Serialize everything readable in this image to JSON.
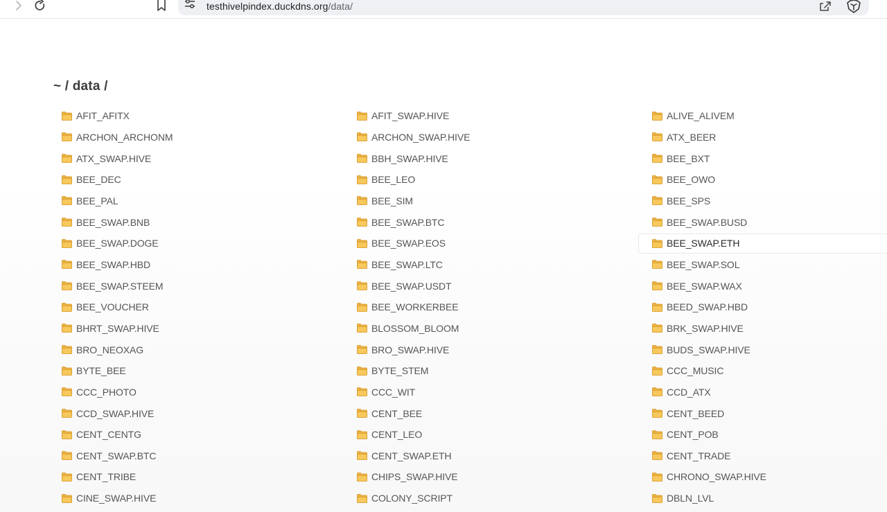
{
  "browser": {
    "url_host": "testhivelpindex.duckdns.org",
    "url_path": "/data/"
  },
  "page": {
    "title": "~ / data /"
  },
  "colors": {
    "folder_fill": "#f7c85c",
    "folder_tab": "#eab142",
    "text": "#555555"
  },
  "entries": [
    "AFIT_AFITX",
    "AFIT_SWAP.HIVE",
    "ALIVE_ALIVEM",
    "ARCHON_ARCHONM",
    "ARCHON_SWAP.HIVE",
    "ATX_BEER",
    "ATX_SWAP.HIVE",
    "BBH_SWAP.HIVE",
    "BEE_BXT",
    "BEE_DEC",
    "BEE_LEO",
    "BEE_OWO",
    "BEE_PAL",
    "BEE_SIM",
    "BEE_SPS",
    "BEE_SWAP.BNB",
    "BEE_SWAP.BTC",
    "BEE_SWAP.BUSD",
    "BEE_SWAP.DOGE",
    "BEE_SWAP.EOS",
    "BEE_SWAP.ETH",
    "BEE_SWAP.HBD",
    "BEE_SWAP.LTC",
    "BEE_SWAP.SOL",
    "BEE_SWAP.STEEM",
    "BEE_SWAP.USDT",
    "BEE_SWAP.WAX",
    "BEE_VOUCHER",
    "BEE_WORKERBEE",
    "BEED_SWAP.HBD",
    "BHRT_SWAP.HIVE",
    "BLOSSOM_BLOOM",
    "BRK_SWAP.HIVE",
    "BRO_NEOXAG",
    "BRO_SWAP.HIVE",
    "BUDS_SWAP.HIVE",
    "BYTE_BEE",
    "BYTE_STEM",
    "CCC_MUSIC",
    "CCC_PHOTO",
    "CCC_WIT",
    "CCD_ATX",
    "CCD_SWAP.HIVE",
    "CENT_BEE",
    "CENT_BEED",
    "CENT_CENTG",
    "CENT_LEO",
    "CENT_POB",
    "CENT_SWAP.BTC",
    "CENT_SWAP.ETH",
    "CENT_TRADE",
    "CENT_TRIBE",
    "CHIPS_SWAP.HIVE",
    "CHRONO_SWAP.HIVE",
    "CINE_SWAP.HIVE",
    "COLONY_SCRIPT",
    "DBLN_LVL"
  ],
  "hovered_entry": "BEE_SWAP.ETH"
}
